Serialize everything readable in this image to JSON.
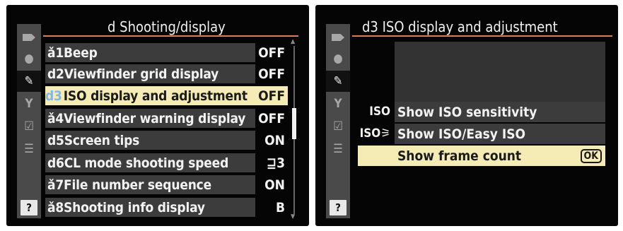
{
  "left_screen": {
    "title": "d Shooting/display",
    "sidebar": [
      {
        "icon": "playback-icon",
        "glyph": "▶"
      },
      {
        "icon": "shooting-icon",
        "glyph": "●"
      },
      {
        "icon": "pencil-icon",
        "glyph": "✎"
      },
      {
        "icon": "wrench-icon",
        "glyph": "Y"
      },
      {
        "icon": "retouch-icon",
        "glyph": "☑"
      },
      {
        "icon": "my-menu-icon",
        "glyph": "☰"
      },
      {
        "icon": "help-icon",
        "glyph": "?"
      }
    ],
    "items": [
      {
        "id": "ǎ1",
        "label": "Beep",
        "value": "OFF"
      },
      {
        "id": "d2",
        "label": "Viewfinder grid display",
        "value": "OFF"
      },
      {
        "id": "d3",
        "label": "ISO display and adjustment",
        "value": "OFF",
        "selected": true
      },
      {
        "id": "ǎ4",
        "label": "Viewfinder warning display",
        "value": "OFF"
      },
      {
        "id": "d5",
        "label": "Screen tips",
        "value": "ON"
      },
      {
        "id": "d6",
        "label": "CL mode shooting speed",
        "value": "⊒3"
      },
      {
        "id": "ǎ7",
        "label": "File number sequence",
        "value": "ON"
      },
      {
        "id": "ǎ8",
        "label": "Shooting info display",
        "value": "B"
      }
    ]
  },
  "right_screen": {
    "title": "d3 ISO display and adjustment",
    "options": [
      {
        "icon_text": "ISO",
        "label": "Show ISO sensitivity"
      },
      {
        "icon_text": "ISO⚞",
        "label": "Show ISO/Easy ISO"
      },
      {
        "icon_text": "",
        "label": "Show frame count",
        "badge": "OK",
        "selected": true
      }
    ]
  }
}
